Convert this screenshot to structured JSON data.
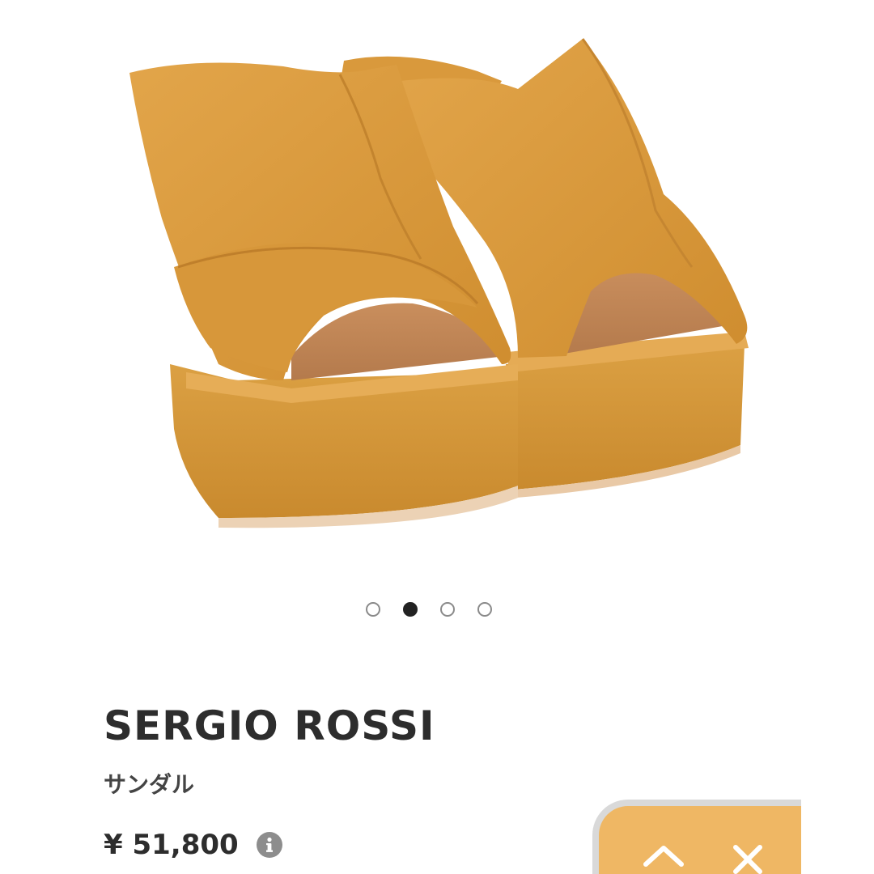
{
  "product": {
    "brand": "SERGIO ROSSI",
    "category": "サンダル",
    "price": "¥ 51,800"
  },
  "carousel": {
    "total": 4,
    "active_index": 1
  },
  "icons": {
    "info": "info-icon",
    "up": "chevron-up-icon",
    "close": "close-icon"
  },
  "colors": {
    "accent_panel": "#efb764",
    "suede": "#d99a3a"
  }
}
